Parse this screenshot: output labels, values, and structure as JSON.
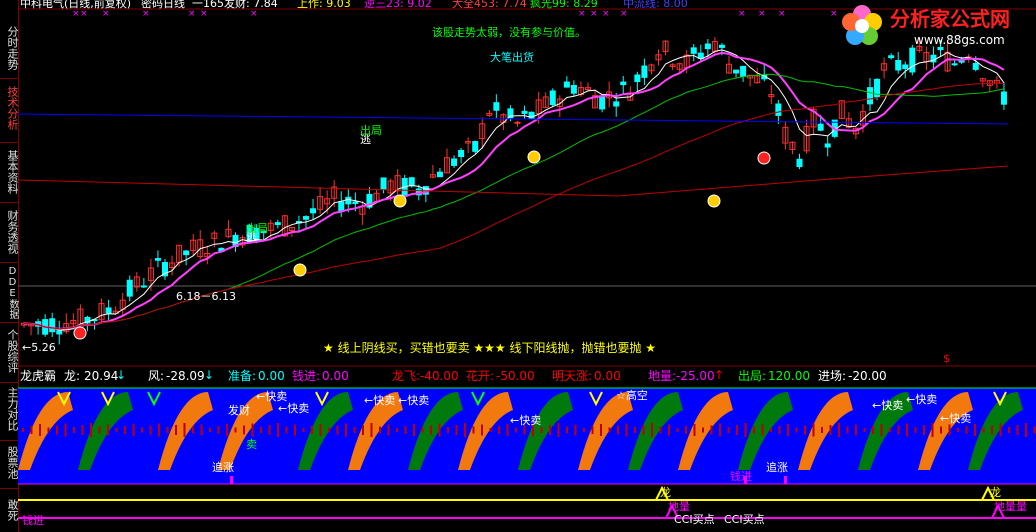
{
  "sidebar": {
    "items": [
      {
        "label": "分时走势"
      },
      {
        "label": "技术分析"
      },
      {
        "label": "基本资料"
      },
      {
        "label": "财务透视"
      },
      {
        "label": "DDE数据"
      },
      {
        "label": "个股综评"
      },
      {
        "label": "主力对比"
      },
      {
        "label": "股票池"
      },
      {
        "label": "敢死"
      }
    ]
  },
  "header": {
    "title": "中科电气(日线,前复权)",
    "formula": "密码日线",
    "items": [
      {
        "text": "一165发财: 7.84",
        "color": "#ffffff"
      },
      {
        "text": "上作: 9.03",
        "color": "#ffff00"
      },
      {
        "text": "逆三23: 9.02",
        "color": "#ff00ff"
      },
      {
        "text": "大全453: 7.74",
        "color": "#ff4040"
      },
      {
        "text": "疯光99: 8.29",
        "color": "#00ff00"
      },
      {
        "text": "中流线: 8.00",
        "color": "#4040ff"
      }
    ]
  },
  "logo": {
    "text": "分析家公式网",
    "url": "www.88gs.com"
  },
  "annotations": {
    "weak_trend": "该股走势太弱，没有参与价值。",
    "big_ship": "大笔出货",
    "escape_1": "逃",
    "escape_1_b": "出局",
    "escape_2": "逃",
    "escape_2_b": "出局",
    "price_range": "6.18－6.13",
    "low_price": "←5.26",
    "motto": "★ 线上阴线买，买错也要卖 ★★★ 线下阳线抛，抛错也要抛 ★",
    "dollar": "$"
  },
  "indicator": {
    "name": "龙虎霸",
    "values": [
      {
        "label": "龙:",
        "value": "20.94",
        "arrow": "↓",
        "color": "#ffffff",
        "arrow_color": "#00ffff"
      },
      {
        "label": "风:",
        "value": "-28.09",
        "arrow": "↓",
        "color": "#ffffff",
        "arrow_color": "#00ffff"
      },
      {
        "label": "准备:",
        "value": "0.00",
        "arrow": "",
        "color": "#00ffff"
      },
      {
        "label": "钱进:",
        "value": "0.00",
        "arrow": "",
        "color": "#ff00ff"
      },
      {
        "label": "龙飞:",
        "value": "-40.00",
        "arrow": "",
        "color": "#ff0000"
      },
      {
        "label": "花开:",
        "value": "-50.00",
        "arrow": "",
        "color": "#ff0000"
      },
      {
        "label": "明天涨:",
        "value": "0.00",
        "arrow": "",
        "color": "#ff0000"
      },
      {
        "label": "地量:",
        "value": "-25.00",
        "arrow": "↑",
        "color": "#ff00ff",
        "arrow_color": "#ff0000"
      },
      {
        "label": "出局:",
        "value": "120.00",
        "arrow": "",
        "color": "#00ff00"
      },
      {
        "label": "进场:",
        "value": "-20.00",
        "arrow": "",
        "color": "#ffffff"
      }
    ]
  },
  "indicator_labels": {
    "quick_sell": "←快卖",
    "gao_kong": "☆高空",
    "fa_cai": "发财",
    "zhui_zhang": "追涨",
    "mai": "卖",
    "qian_jin": "钱进",
    "long": "龙",
    "di_liang": "地量",
    "cci_buy": "CCI买点",
    "zhui_zhang2": "追涨",
    "qian_jin2": "钱进",
    "di_liang2": "地量量"
  },
  "colors": {
    "up": "#ff3030",
    "down": "#00ffff",
    "ma_white": "#ffffff",
    "ma_magenta": "#ff40ff",
    "ma_green": "#00c000",
    "ma_red": "#c00000",
    "ma_blue": "#0000ff",
    "panel_blue": "#0000ff",
    "orange": "#ff8000",
    "dark_green": "#008000"
  }
}
